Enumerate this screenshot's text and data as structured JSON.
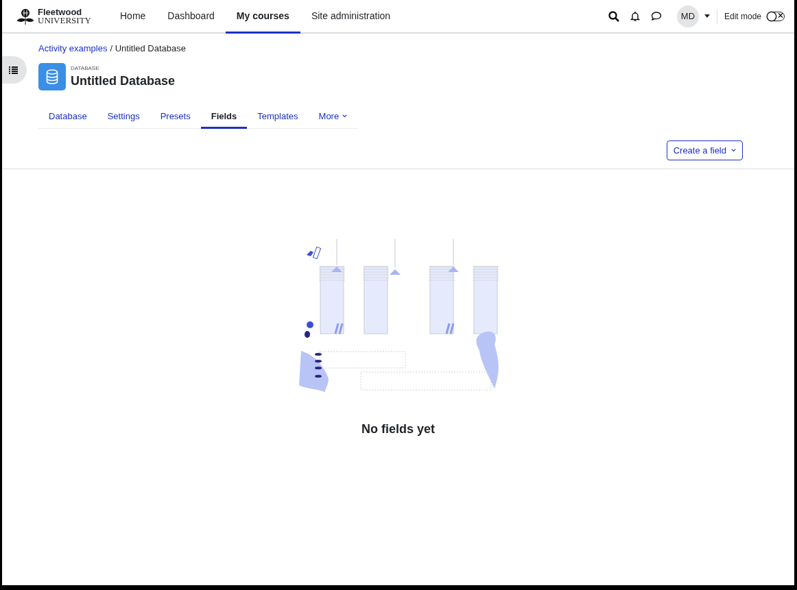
{
  "brand": {
    "name": "Fleetwood",
    "subtitle": "UNIVERSITY"
  },
  "nav": [
    {
      "label": "Home",
      "selected": false
    },
    {
      "label": "Dashboard",
      "selected": false
    },
    {
      "label": "My courses",
      "selected": true
    },
    {
      "label": "Site administration",
      "selected": false
    }
  ],
  "user": {
    "initials": "MD"
  },
  "edit_mode": {
    "label": "Edit mode",
    "on": false
  },
  "breadcrumb": {
    "link": "Activity examples",
    "current": "/ Untitled Database"
  },
  "activity": {
    "type": "DATABASE",
    "title": "Untitled Database"
  },
  "tabs": [
    {
      "label": "Database",
      "selected": false,
      "kind": "link"
    },
    {
      "label": "Settings",
      "selected": false,
      "kind": "link"
    },
    {
      "label": "Presets",
      "selected": false,
      "kind": "link"
    },
    {
      "label": "Fields",
      "selected": true,
      "kind": "link"
    },
    {
      "label": "Templates",
      "selected": false,
      "kind": "link"
    },
    {
      "label": "More",
      "selected": false,
      "kind": "menu"
    }
  ],
  "action_button": "Create a field",
  "empty_message": "No fields yet"
}
